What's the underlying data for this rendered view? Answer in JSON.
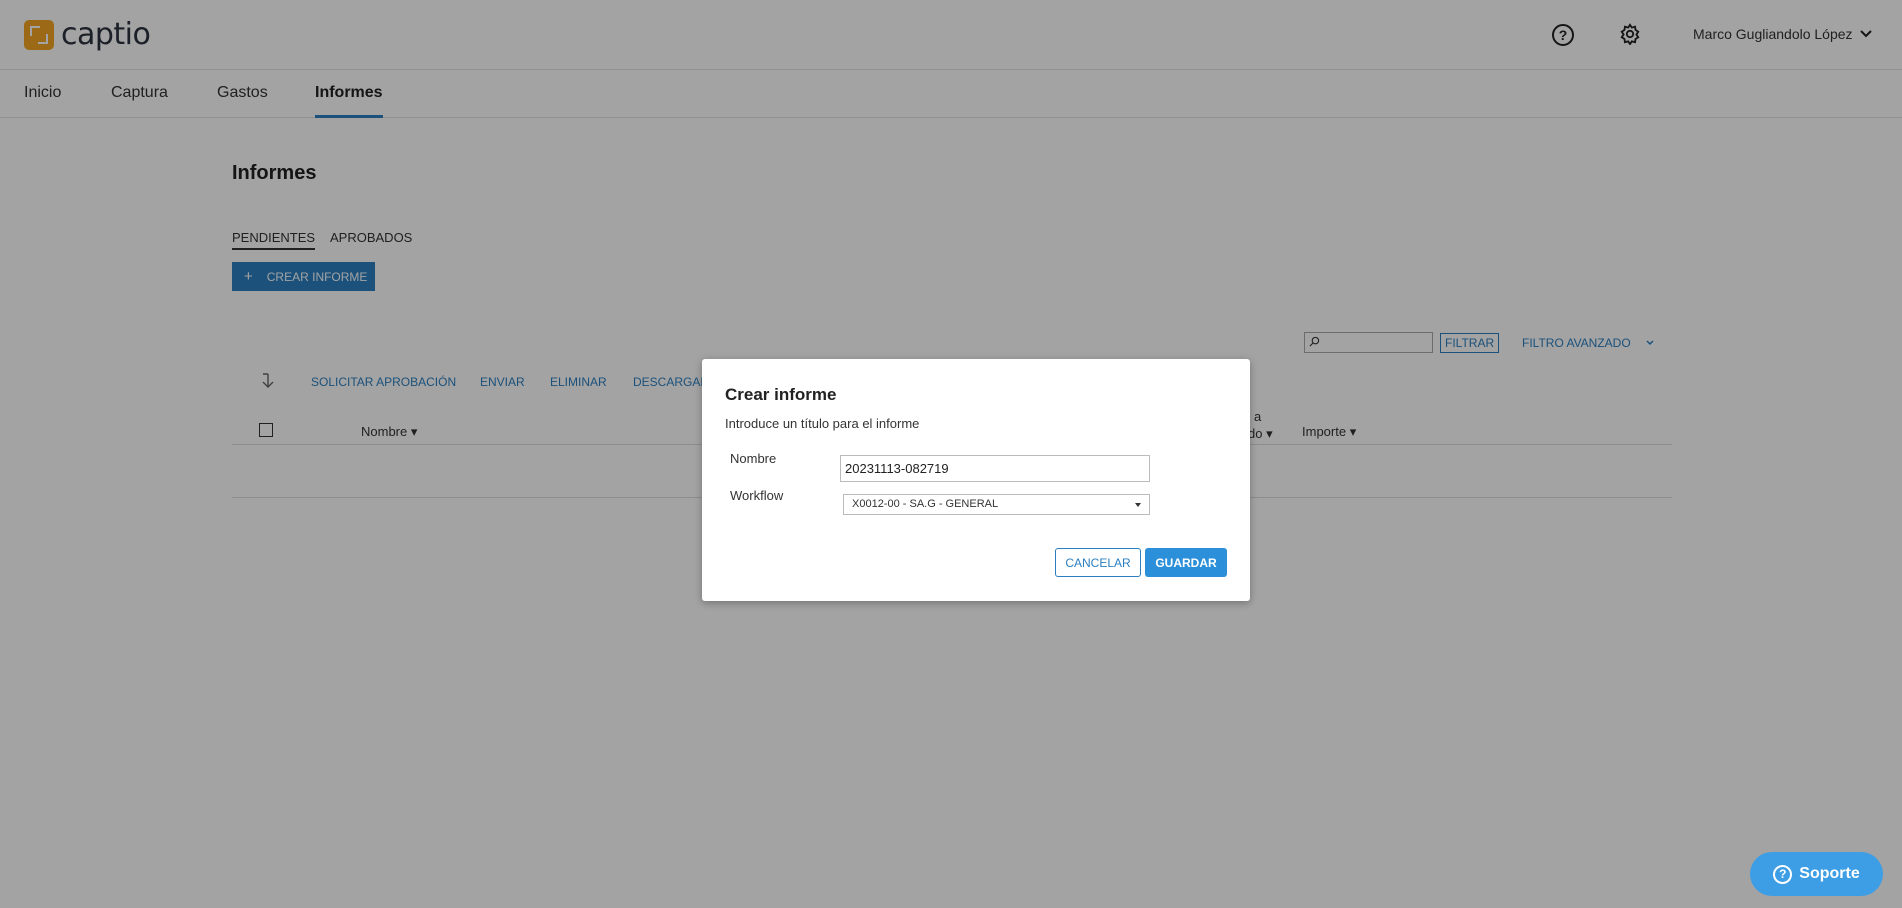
{
  "header": {
    "logo_text": "captio",
    "help_icon": "question-circle-icon",
    "settings_icon": "gear-icon",
    "user_name": "Marco Gugliandolo López"
  },
  "nav": {
    "items": [
      {
        "label": "Inicio"
      },
      {
        "label": "Captura"
      },
      {
        "label": "Gastos"
      },
      {
        "label": "Informes",
        "active": true
      }
    ]
  },
  "page": {
    "title": "Informes",
    "tabs": [
      {
        "label": "PENDIENTES",
        "active": true
      },
      {
        "label": "APROBADOS"
      }
    ],
    "create_button": "CREAR INFORME",
    "filter_button": "FILTRAR",
    "advanced_filter": "FILTRO AVANZADO",
    "actions": [
      "SOLICITAR APROBACIÓN",
      "ENVIAR",
      "ELIMINAR",
      "DESCARGAR"
    ],
    "columns": {
      "name": "Nombre",
      "partial_top": "a",
      "partial_bottom": "do",
      "amount": "Importe"
    }
  },
  "modal": {
    "title": "Crear informe",
    "subtitle": "Introduce un título para el informe",
    "name_label": "Nombre",
    "name_value": "20231113-082719",
    "workflow_label": "Workflow",
    "workflow_value": "X0012-00 - SA.G - GENERAL",
    "cancel_label": "CANCELAR",
    "save_label": "GUARDAR"
  },
  "support": {
    "label": "Soporte"
  },
  "colors": {
    "accent": "#2b7fc0",
    "logo": "#f5a623",
    "support": "#3d9ee5"
  }
}
